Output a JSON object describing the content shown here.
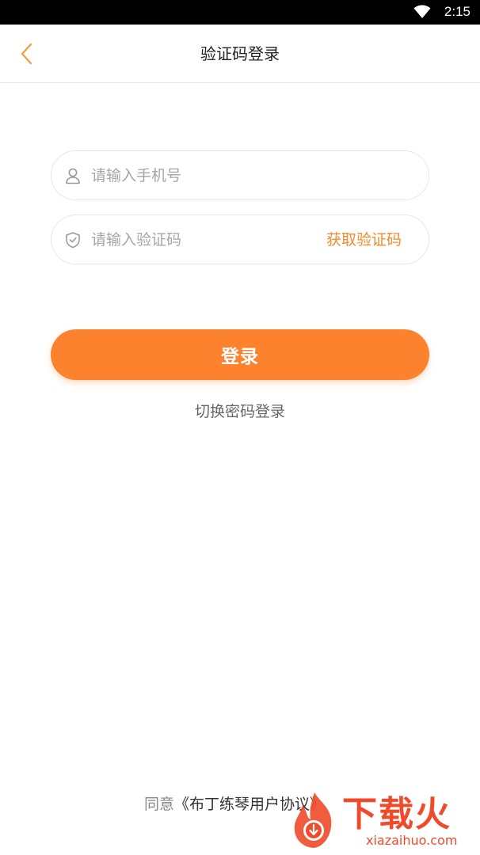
{
  "status_bar": {
    "time": "2:15",
    "icons": [
      "wifi-icon"
    ]
  },
  "header": {
    "title": "验证码登录",
    "back_icon": "chevron-left-icon"
  },
  "form": {
    "phone": {
      "placeholder": "请输入手机号",
      "value": "",
      "icon": "user-icon"
    },
    "code": {
      "placeholder": "请输入验证码",
      "value": "",
      "icon": "shield-icon",
      "get_code_label": "获取验证码"
    },
    "login_label": "登录",
    "switch_label": "切换密码登录"
  },
  "agreement": {
    "prefix": "同意",
    "doc": "《布丁练琴用户协议》"
  },
  "watermark": {
    "text": "下载火",
    "url": "xiazaihuo.com"
  },
  "colors": {
    "accent": "#fd822d",
    "accent_text": "#f5892d",
    "placeholder": "#a6a6a6",
    "border": "#e6e6e6",
    "title": "#222222"
  }
}
